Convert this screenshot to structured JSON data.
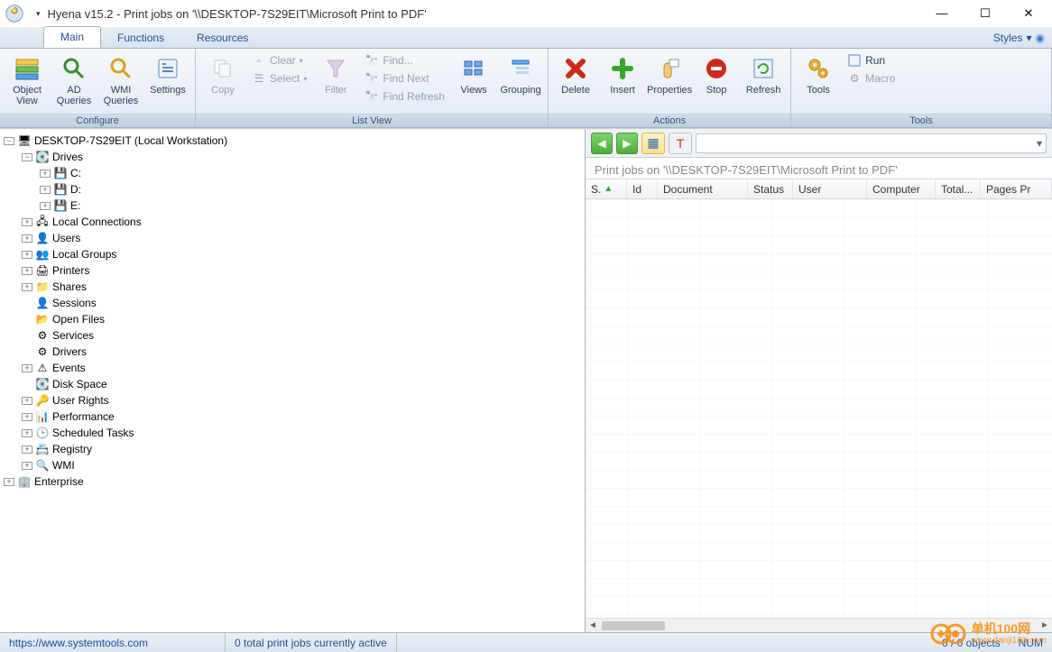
{
  "window": {
    "title": "Hyena v15.2 - Print jobs on '\\\\DESKTOP-7S29EIT\\Microsoft Print to PDF'"
  },
  "tabs": {
    "main": "Main",
    "functions": "Functions",
    "resources": "Resources",
    "styles": "Styles"
  },
  "ribbon": {
    "configure": {
      "label": "Configure",
      "object_view": "Object\nView",
      "ad_queries": "AD\nQueries",
      "wmi_queries": "WMI\nQueries",
      "settings": "Settings"
    },
    "listview": {
      "label": "List View",
      "copy": "Copy",
      "clear": "Clear",
      "select": "Select",
      "filter": "Filter",
      "find": "Find...",
      "find_next": "Find Next",
      "find_refresh": "Find Refresh",
      "views": "Views",
      "grouping": "Grouping"
    },
    "actions": {
      "label": "Actions",
      "delete": "Delete",
      "insert": "Insert",
      "properties": "Properties",
      "stop": "Stop",
      "refresh": "Refresh"
    },
    "tools": {
      "label": "Tools",
      "tools": "Tools",
      "run": "Run",
      "macro": "Macro"
    }
  },
  "tree": {
    "root": "DESKTOP-7S29EIT (Local Workstation)",
    "drives": "Drives",
    "drive_c": "C:",
    "drive_d": "D:",
    "drive_e": "E:",
    "local_connections": "Local Connections",
    "users": "Users",
    "local_groups": "Local Groups",
    "printers": "Printers",
    "shares": "Shares",
    "sessions": "Sessions",
    "open_files": "Open Files",
    "services": "Services",
    "drivers": "Drivers",
    "events": "Events",
    "disk_space": "Disk Space",
    "user_rights": "User Rights",
    "performance": "Performance",
    "scheduled_tasks": "Scheduled Tasks",
    "registry": "Registry",
    "wmi": "WMI",
    "enterprise": "Enterprise"
  },
  "list": {
    "title": "Print jobs on '\\\\DESKTOP-7S29EIT\\Microsoft Print to PDF'",
    "columns": {
      "s": "S.",
      "id": "Id",
      "document": "Document",
      "status": "Status",
      "user": "User",
      "computer": "Computer",
      "total": "Total...",
      "pages": "Pages Pr"
    }
  },
  "status": {
    "url": "https://www.systemtools.com",
    "jobs": "0 total print jobs currently active",
    "objects": "0 / 0 objects",
    "num": "NUM"
  },
  "watermark": {
    "main": "单机100网",
    "sub": "www.danji100.com"
  }
}
